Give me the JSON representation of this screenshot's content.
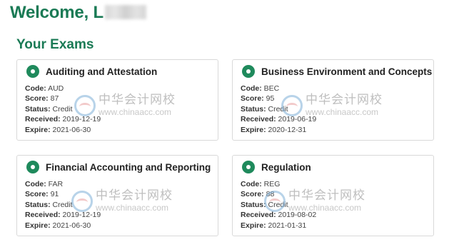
{
  "header": {
    "welcome": "Welcome, L"
  },
  "section": {
    "title": "Your Exams"
  },
  "labels": {
    "code": "Code:",
    "score": "Score:",
    "status": "Status:",
    "received": "Received:",
    "expire": "Expire:"
  },
  "exams": [
    {
      "title": "Auditing and Attestation",
      "code": "AUD",
      "score": "87",
      "status": "Credit",
      "received": "2019-12-19",
      "expire": "2021-06-30"
    },
    {
      "title": "Business Environment and Concepts",
      "code": "BEC",
      "score": "95",
      "status": "Credit",
      "received": "2019-06-19",
      "expire": "2020-12-31"
    },
    {
      "title": "Financial Accounting and Reporting",
      "code": "FAR",
      "score": "91",
      "status": "Credit",
      "received": "2019-12-19",
      "expire": "2021-06-30"
    },
    {
      "title": "Regulation",
      "code": "REG",
      "score": "88",
      "status": "Credit",
      "received": "2019-08-02",
      "expire": "2021-01-31"
    }
  ],
  "watermark": {
    "cn": "中华会计网校",
    "url": "www.chinaacc.com"
  },
  "colors": {
    "accent": "#1a7a55",
    "status_dot": "#1f8a5c",
    "card_border": "#d9d9d9"
  }
}
